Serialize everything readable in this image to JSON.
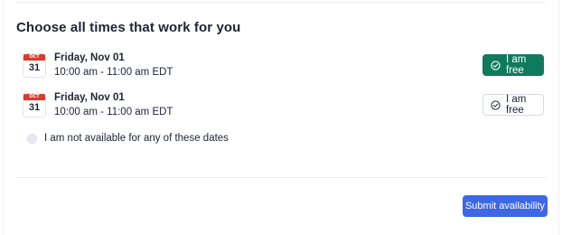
{
  "heading": "Choose all times that work for you",
  "slots": [
    {
      "calendar_month": "OCT",
      "calendar_day": "31",
      "date": "Friday, Nov 01",
      "time": "10:00 am - 11:00 am EDT",
      "button_label": "I am free",
      "selected": true
    },
    {
      "calendar_month": "OCT",
      "calendar_day": "31",
      "date": "Friday, Nov 01",
      "time": "10:00 am - 11:00 am EDT",
      "button_label": "I am free",
      "selected": false
    }
  ],
  "not_available_label": "I am not available for any of these dates",
  "submit_label": "Submit availability",
  "colors": {
    "selected_green": "#0f7a5e",
    "submit_blue": "#3e67e6",
    "calendar_red": "#d93b2e"
  },
  "icons": {
    "calendar": "calendar-icon",
    "check": "check-circle-icon"
  }
}
